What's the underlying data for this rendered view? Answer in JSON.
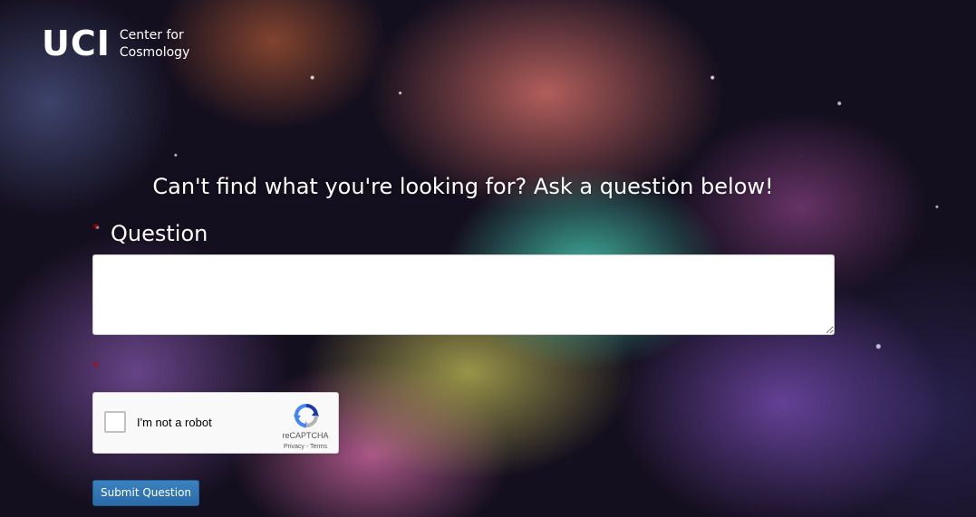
{
  "header": {
    "logo_mark": "UCI",
    "logo_line1": "Center for",
    "logo_line2": "Cosmology"
  },
  "form": {
    "prompt": "Can't find what you're looking for? Ask a question below!",
    "required_marker": "*",
    "question_label": "Question",
    "question_value": "",
    "submit_label": "Submit Question"
  },
  "captcha": {
    "label": "I'm not a robot",
    "brand": "reCAPTCHA",
    "privacy": "Privacy",
    "separator": " - ",
    "terms": "Terms",
    "checked": false
  },
  "colors": {
    "required": "#cc0000",
    "button": "#2f75b3",
    "recaptcha_blue": "#1c3aa9",
    "recaptcha_light": "#4285f4",
    "recaptcha_grey": "#b3b3b3"
  },
  "icons": {
    "captcha_logo": "recaptcha-logo-icon",
    "captcha_checkbox": "checkbox-icon"
  }
}
